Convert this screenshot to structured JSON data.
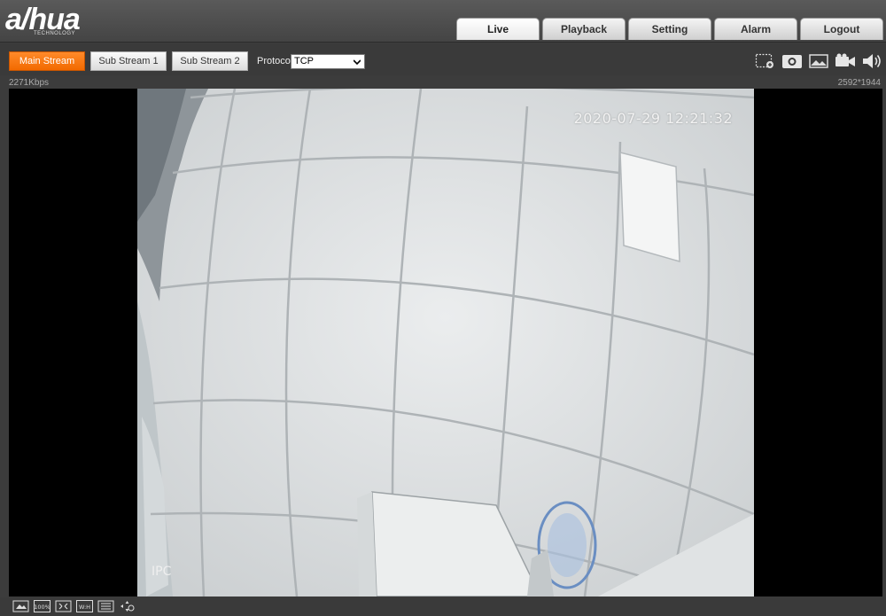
{
  "brand": {
    "logo_text": "a/hua",
    "logo_subtext": "TECHNOLOGY"
  },
  "nav": {
    "tabs": [
      {
        "label": "Live",
        "active": true
      },
      {
        "label": "Playback"
      },
      {
        "label": "Setting"
      },
      {
        "label": "Alarm"
      },
      {
        "label": "Logout"
      }
    ]
  },
  "toolbar": {
    "main_stream_label": "Main Stream",
    "sub_stream1_label": "Sub Stream 1",
    "sub_stream2_label": "Sub Stream 2",
    "protocol_label": "Protocol",
    "protocol_value": "TCP",
    "active_color": "#f26a00",
    "icons": [
      "region-zoom-icon",
      "snapshot-icon",
      "triple-snapshot-icon",
      "record-icon",
      "audio-icon"
    ]
  },
  "status": {
    "bitrate": "2271Kbps",
    "resolution": "2592*1944"
  },
  "video": {
    "timestamp": "2020-07-29 12:21:32",
    "channel_name": "IPC"
  },
  "bottom_bar": {
    "icons": [
      "original-size-icon",
      "100-percent-icon",
      "fullscreen-icon",
      "wh-ratio-icon",
      "fluency-icon",
      "ptz-icon"
    ],
    "percent_label": "100%",
    "wh_label": "W:H"
  }
}
